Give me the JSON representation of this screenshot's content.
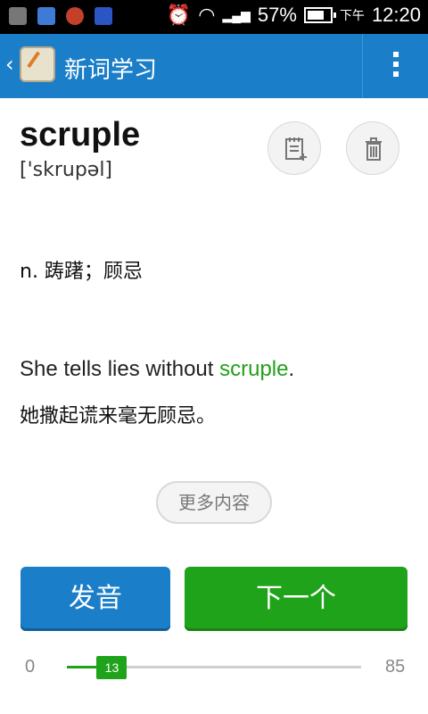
{
  "status_bar": {
    "battery": "57%",
    "ampm": "下午",
    "time": "12:20"
  },
  "app_bar": {
    "title": "新词学习"
  },
  "word": {
    "headword": "scruple",
    "phonetic": "['skrupəl]",
    "meaning": "n. 踌躇；顾忌",
    "example_before": "She tells lies without ",
    "example_highlight": "scruple",
    "example_after": ".",
    "translation": "她撒起谎来毫无顾忌。",
    "highlight_color": "#22a01b"
  },
  "more_label": "更多内容",
  "buttons": {
    "pronounce": "发音",
    "next": "下一个"
  },
  "progress": {
    "min": "0",
    "max": "85",
    "current": "13",
    "current_value": 13,
    "max_value": 85
  },
  "colors": {
    "primary": "#1a7ec9",
    "success": "#1fa31a"
  },
  "icons": {
    "note": "note-add-icon",
    "trash": "trash-icon",
    "back": "chevron-left-icon",
    "menu": "overflow-menu-icon"
  }
}
